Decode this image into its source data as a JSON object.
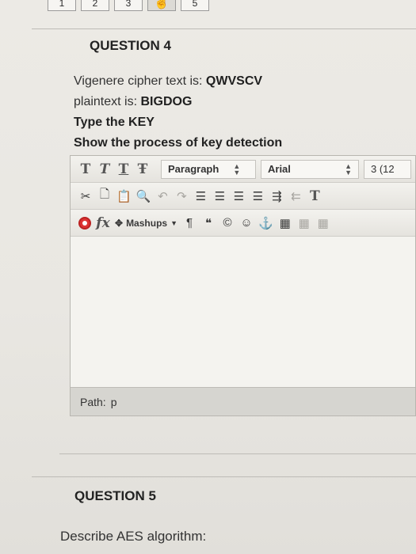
{
  "pager": {
    "pages": [
      "1",
      "2",
      "3",
      "4",
      "5"
    ],
    "current": "4"
  },
  "question4": {
    "title": "QUESTION 4",
    "cipher_label": "Vigenere cipher text is:",
    "cipher_value": "QWVSCV",
    "plain_label": "plaintext is:",
    "plain_value": "BIGDOG",
    "instruction1": "Type the KEY",
    "instruction2": "Show the process of key detection"
  },
  "editor": {
    "toolbar1": {
      "t1": "T",
      "t2": "T",
      "t3": "T",
      "t4": "Ŧ",
      "format": "Paragraph",
      "font": "Arial",
      "size": "3 (12"
    },
    "toolbar3": {
      "fx": "fx",
      "mashups": "Mashups"
    },
    "path_label": "Path:",
    "path_value": "p"
  },
  "question5": {
    "title": "QUESTION 5",
    "prompt": "Describe AES algorithm:"
  }
}
